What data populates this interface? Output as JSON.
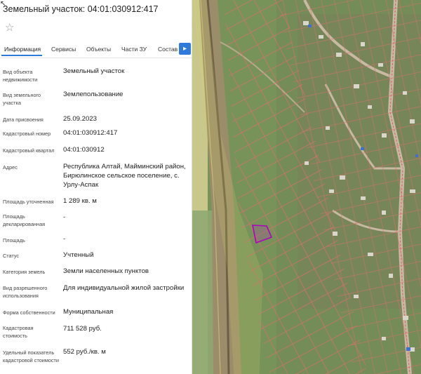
{
  "title": "Земельный участок: 04:01:030912:417",
  "tabs": [
    {
      "label": "Информация",
      "active": true
    },
    {
      "label": "Сервисы"
    },
    {
      "label": "Объекты"
    },
    {
      "label": "Части ЗУ"
    },
    {
      "label": "Состав"
    }
  ],
  "tabs_next_icon": "chevron-right-icon",
  "accent_color": "#2f7bdc",
  "fields": [
    {
      "label": "Вид объекта недвижимости",
      "value": "Земельный участок"
    },
    {
      "label": "Вид земельного участка",
      "value": "Землепользование"
    },
    {
      "label": "Дата присвоения",
      "value": "25.09.2023"
    },
    {
      "label": "Кадастровый номер",
      "value": "04:01:030912:417"
    },
    {
      "label": "Кадастровый квартал",
      "value": "04:01:030912"
    },
    {
      "label": "Адрес",
      "value": "Республика Алтай, Майминский район, Бирюлинское сельское поселение, с. Урлу-Аспак"
    },
    {
      "label": "Площадь уточненная",
      "value": "1 289 кв. м"
    },
    {
      "label": "Площадь декларированная",
      "value": "-"
    },
    {
      "label": "Площадь",
      "value": "-"
    },
    {
      "label": "Статус",
      "value": "Учтенный"
    },
    {
      "label": "Категория земель",
      "value": "Земли населенных пунктов"
    },
    {
      "label": "Вид разрешенного использования",
      "value": "Для индивидуальной жилой застройки"
    },
    {
      "label": "Форма собственности",
      "value": "Муниципальная"
    },
    {
      "label": "Кадастровая стоимость",
      "value": "711 528 руб."
    },
    {
      "label": "Удельный показатель кадастровой стоимости",
      "value": "552 руб./кв. м"
    }
  ]
}
